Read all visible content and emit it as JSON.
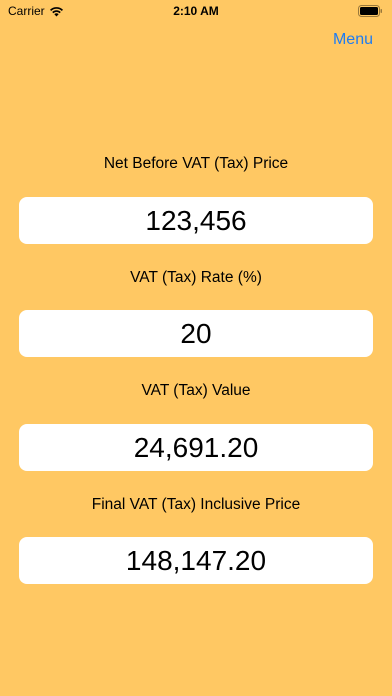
{
  "status_bar": {
    "carrier": "Carrier",
    "time": "2:10 AM",
    "wifi_icon": "wifi-icon",
    "battery_icon": "battery-icon"
  },
  "nav": {
    "menu_label": "Menu",
    "accent_color": "#1E7CF2"
  },
  "background_color": "#FFC863",
  "fields": [
    {
      "label": "Net Before VAT (Tax) Price",
      "value": "123,456"
    },
    {
      "label": "VAT (Tax) Rate (%)",
      "value": "20"
    },
    {
      "label": "VAT (Tax) Value",
      "value": "24,691.20"
    },
    {
      "label": "Final VAT (Tax) Inclusive Price",
      "value": "148,147.20"
    }
  ]
}
